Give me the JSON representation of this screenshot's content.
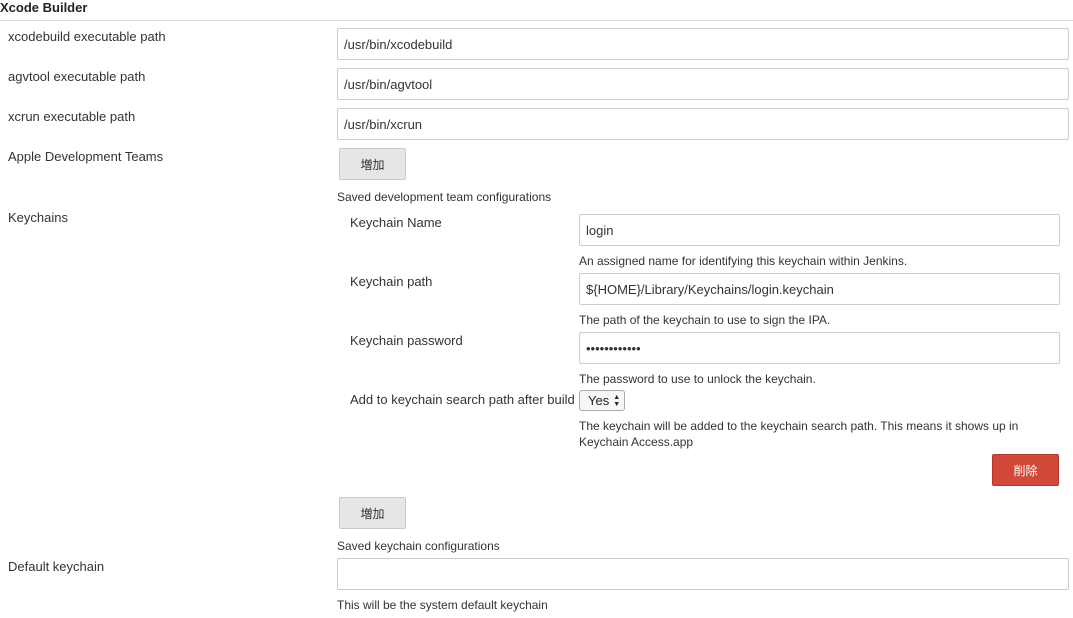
{
  "section": {
    "title": "Xcode Builder"
  },
  "xcodebuild": {
    "label": "xcodebuild executable path",
    "value": "/usr/bin/xcodebuild"
  },
  "agvtool": {
    "label": "agvtool executable path",
    "value": "/usr/bin/agvtool"
  },
  "xcrun": {
    "label": "xcrun executable path",
    "value": "/usr/bin/xcrun"
  },
  "teams": {
    "label": "Apple Development Teams",
    "add_label": "増加",
    "help": "Saved development team configurations"
  },
  "keychains": {
    "label": "Keychains",
    "name": {
      "label": "Keychain Name",
      "value": "login",
      "help": "An assigned name for identifying this keychain within Jenkins."
    },
    "path": {
      "label": "Keychain path",
      "value": "${HOME}/Library/Keychains/login.keychain",
      "help": "The path of the keychain to use to sign the IPA."
    },
    "password": {
      "label": "Keychain password",
      "value": "••••••••••••",
      "help": "The password to use to unlock the keychain."
    },
    "search_path": {
      "label": "Add to keychain search path after build",
      "selected": "Yes",
      "help": "The keychain will be added to the keychain search path. This means it shows up in Keychain Access.app"
    },
    "delete_label": "削除",
    "add_label": "増加",
    "help": "Saved keychain configurations"
  },
  "default_keychain": {
    "label": "Default keychain",
    "value": "",
    "help": "This will be the system default keychain"
  },
  "colors": {
    "delete_button": "#d24939",
    "add_button": "#e6e6e6",
    "input_border": "#cccccc"
  },
  "icons": {
    "select_arrows": "up-down-arrows-icon"
  }
}
